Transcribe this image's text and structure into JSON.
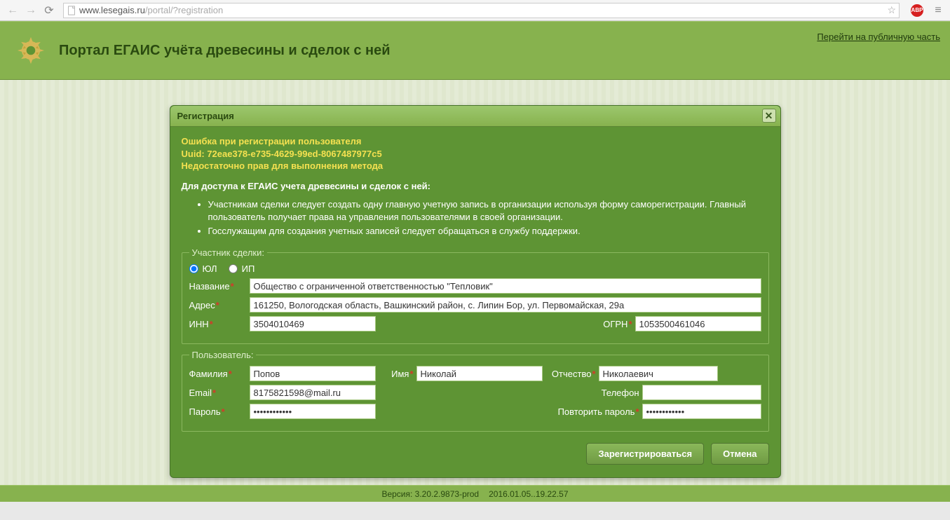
{
  "browser": {
    "url_host": "www.lesegais.ru",
    "url_path": "/portal/?registration"
  },
  "header": {
    "title": "Портал ЕГАИС учёта древесины и сделок с ней",
    "public_link": "Перейти на публичную часть"
  },
  "modal": {
    "title": "Регистрация",
    "error_line1": "Ошибка при регистрации пользователя",
    "error_line2": "Uuid: 72eae378-e735-4629-99ed-8067487977c5",
    "error_line3": "Недостаточно прав для выполнения метода",
    "intro": "Для доступа к ЕГАИС учета древесины и сделок с ней:",
    "intro_item1": "Участникам сделки следует создать одну главную учетную запись в организации используя форму саморегистрации. Главный пользователь получает права на управления пользователями в своей организации.",
    "intro_item2": "Госслужащим для создания учетных записей следует обращаться в службу поддержки."
  },
  "participant": {
    "legend": "Участник сделки:",
    "radio_ul": "ЮЛ",
    "radio_ip": "ИП",
    "name_label": "Название",
    "name_value": "Общество с ограниченной ответственностью \"Тепловик\"",
    "address_label": "Адрес",
    "address_value": "161250, Вологодская область, Вашкинский район, с. Липин Бор, ул. Первомайская, 29а",
    "inn_label": "ИНН",
    "inn_value": "3504010469",
    "ogrn_label": "ОГРН",
    "ogrn_value": "1053500461046"
  },
  "user": {
    "legend": "Пользователь:",
    "lastname_label": "Фамилия",
    "lastname_value": "Попов",
    "firstname_label": "Имя",
    "firstname_value": "Николай",
    "patronymic_label": "Отчество",
    "patronymic_value": "Николаевич",
    "email_label": "Email",
    "email_value": "8175821598@mail.ru",
    "phone_label": "Телефон",
    "phone_value": "",
    "password_label": "Пароль",
    "password_value": "••••••••••••",
    "password2_label": "Повторить пароль",
    "password2_value": "••••••••••••"
  },
  "buttons": {
    "register": "Зарегистрироваться",
    "cancel": "Отмена"
  },
  "footer": {
    "version": "Версия: 3.20.2.9873-prod",
    "date": "2016.01.05..19.22.57"
  }
}
